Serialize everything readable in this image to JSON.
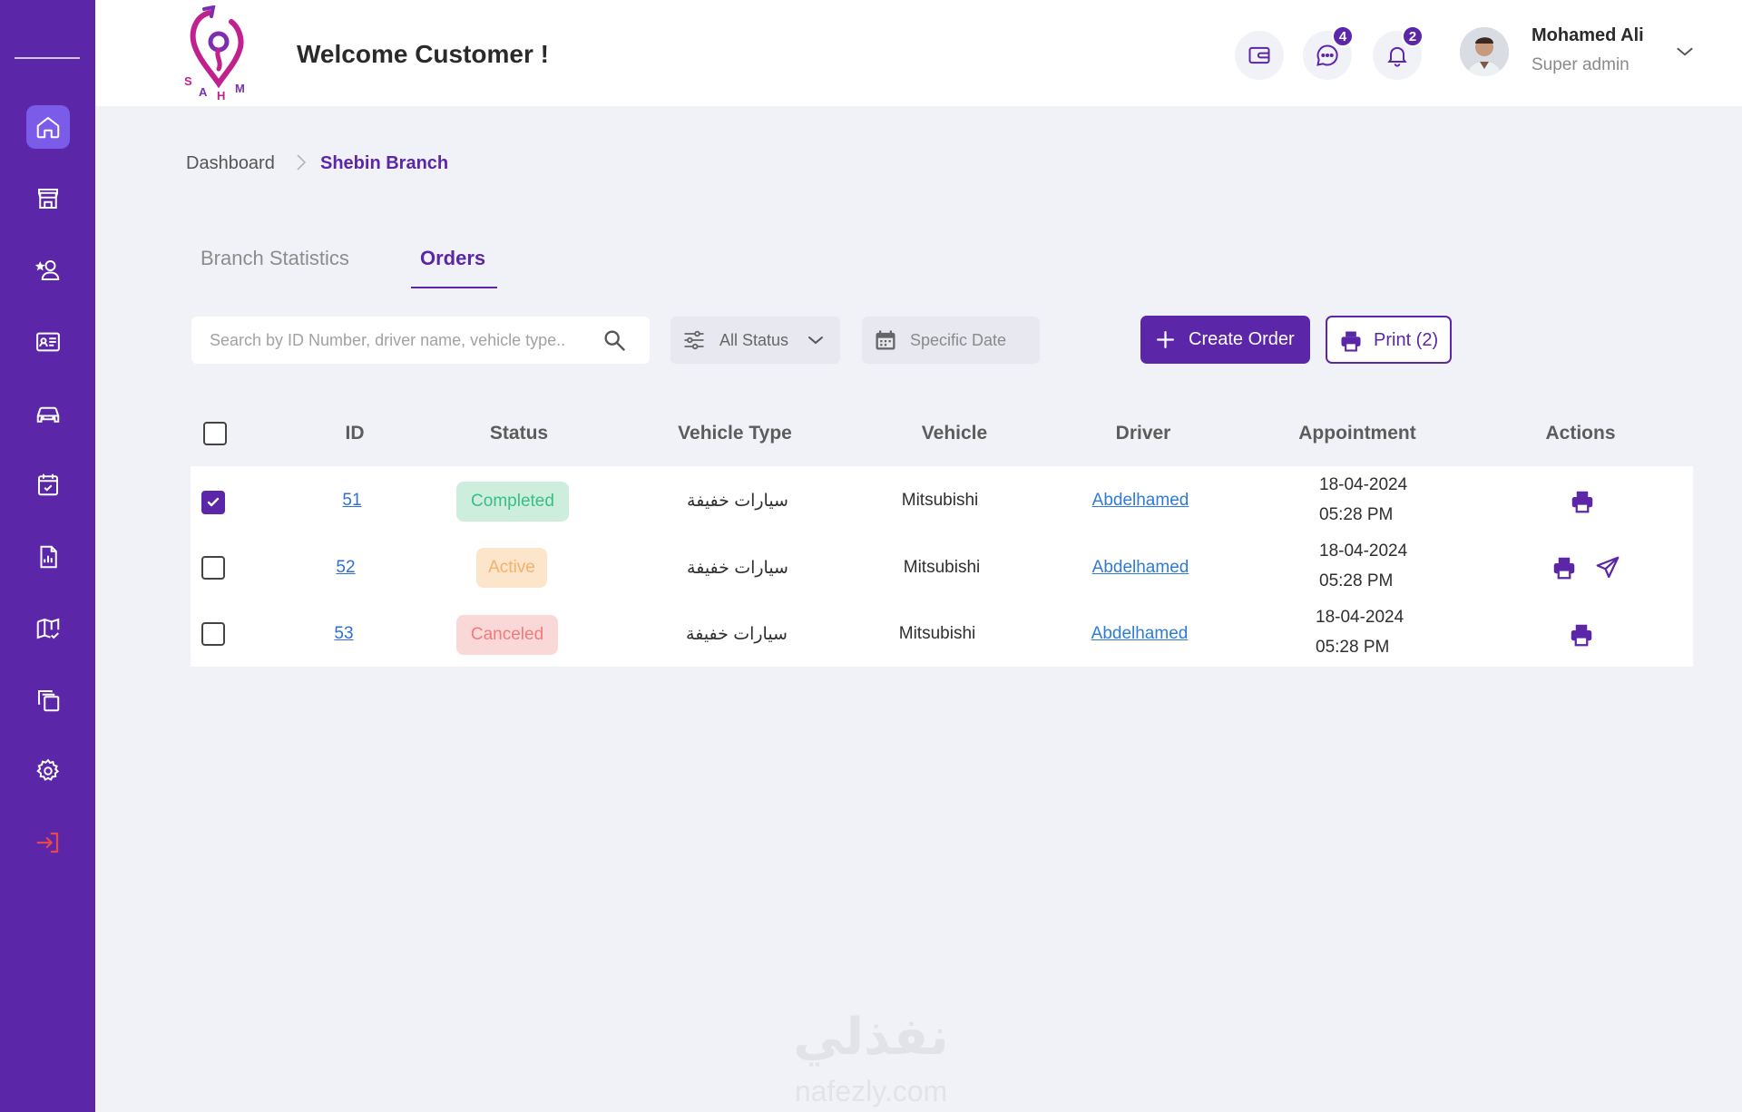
{
  "app": {
    "brand": "SAHM",
    "welcome": "Welcome Customer !"
  },
  "header": {
    "messages_count": "4",
    "notifications_count": "2",
    "user": {
      "name": "Mohamed Ali",
      "role": "Super admin"
    }
  },
  "sidebar": {
    "items": [
      {
        "icon": "home-icon",
        "active": true
      },
      {
        "icon": "store-icon"
      },
      {
        "icon": "user-star-icon"
      },
      {
        "icon": "id-card-icon"
      },
      {
        "icon": "car-icon"
      },
      {
        "icon": "calendar-check-icon"
      },
      {
        "icon": "report-icon"
      },
      {
        "icon": "map-check-icon"
      },
      {
        "icon": "copy-icon"
      },
      {
        "icon": "gear-icon"
      },
      {
        "icon": "logout-icon"
      }
    ]
  },
  "breadcrumb": {
    "root": "Dashboard",
    "current": "Shebin Branch"
  },
  "tabs": [
    {
      "label": "Branch Statistics",
      "active": false
    },
    {
      "label": "Orders",
      "active": true
    }
  ],
  "toolbar": {
    "search_placeholder": "Search by ID Number, driver name, vehicle type..",
    "status_filter": "All Status",
    "date_filter": "Specific Date",
    "create_label": "Create Order",
    "print_label": "Print (2)"
  },
  "table": {
    "columns": [
      "ID",
      "Status",
      "Vehicle Type",
      "Vehicle",
      "Driver",
      "Appointment",
      "Actions"
    ],
    "rows": [
      {
        "checked": true,
        "id": "51",
        "status": "Completed",
        "vehicle_type": "سيارات خفيفة",
        "vehicle": "Mitsubishi",
        "driver": "Abdelhamed",
        "date": "18-04-2024",
        "time": "05:28 PM",
        "actions": [
          "print"
        ]
      },
      {
        "checked": false,
        "id": "52",
        "status": "Active",
        "vehicle_type": "سيارات خفيفة",
        "vehicle": "Mitsubishi",
        "driver": "Abdelhamed",
        "date": "18-04-2024",
        "time": "05:28 PM",
        "actions": [
          "print",
          "send"
        ]
      },
      {
        "checked": false,
        "id": "53",
        "status": "Canceled",
        "vehicle_type": "سيارات خفيفة",
        "vehicle": "Mitsubishi",
        "driver": "Abdelhamed",
        "date": "18-04-2024",
        "time": "05:28 PM",
        "actions": [
          "print"
        ]
      }
    ]
  },
  "watermark": {
    "arabic": "نفذلي",
    "latin": "nafezly.com"
  },
  "colors": {
    "primary": "#5b26a8",
    "active_nav": "#7a5ce8",
    "completed": "#3bbd83",
    "active": "#f6b06a",
    "canceled": "#ef7b7b",
    "logout": "#e5484d"
  }
}
